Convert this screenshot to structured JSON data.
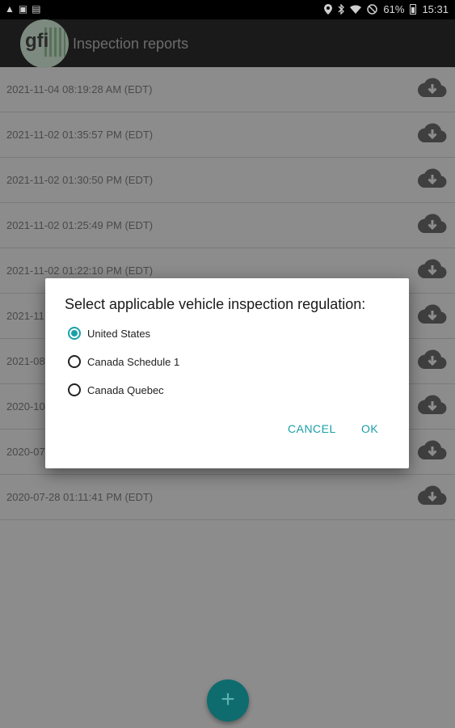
{
  "status_bar": {
    "left_icons": [
      "warning-icon",
      "image-icon",
      "document-icon"
    ],
    "right_icons": [
      "location-icon",
      "bluetooth-icon",
      "wifi-icon",
      "do-not-disturb-icon"
    ],
    "battery": "61%",
    "time": "15:31"
  },
  "app_bar": {
    "logo_text": "gfi",
    "title": "Inspection reports"
  },
  "reports": [
    {
      "label": "2021-11-04 08:19:28 AM (EDT)",
      "icon": "cloud-download-icon"
    },
    {
      "label": "2021-11-02 01:35:57 PM (EDT)",
      "icon": "cloud-download-icon"
    },
    {
      "label": "2021-11-02 01:30:50 PM (EDT)",
      "icon": "cloud-download-icon"
    },
    {
      "label": "2021-11-02 01:25:49 PM (EDT)",
      "icon": "cloud-download-icon"
    },
    {
      "label": "2021-11-02 01:22:10 PM (EDT)",
      "icon": "cloud-download-icon"
    },
    {
      "label": "2021-11",
      "icon": "cloud-download-icon"
    },
    {
      "label": "2021-08",
      "icon": "cloud-download-icon"
    },
    {
      "label": "2020-10",
      "icon": "cloud-download-icon"
    },
    {
      "label": "2020-07",
      "icon": "cloud-download-icon"
    },
    {
      "label": "2020-07-28 01:11:41 PM (EDT)",
      "icon": "cloud-download-icon"
    }
  ],
  "dialog": {
    "title": "Select applicable vehicle inspection regulation:",
    "options": [
      {
        "label": "United States",
        "selected": true
      },
      {
        "label": "Canada Schedule 1",
        "selected": false
      },
      {
        "label": "Canada Quebec",
        "selected": false
      }
    ],
    "cancel_label": "CANCEL",
    "ok_label": "OK"
  },
  "fab": {
    "label": "+"
  },
  "colors": {
    "accent": "#1aa0a8",
    "fab": "#0e6b6e",
    "scrim_background": "#8c8c8c",
    "app_bar": "#1a1a1a"
  }
}
